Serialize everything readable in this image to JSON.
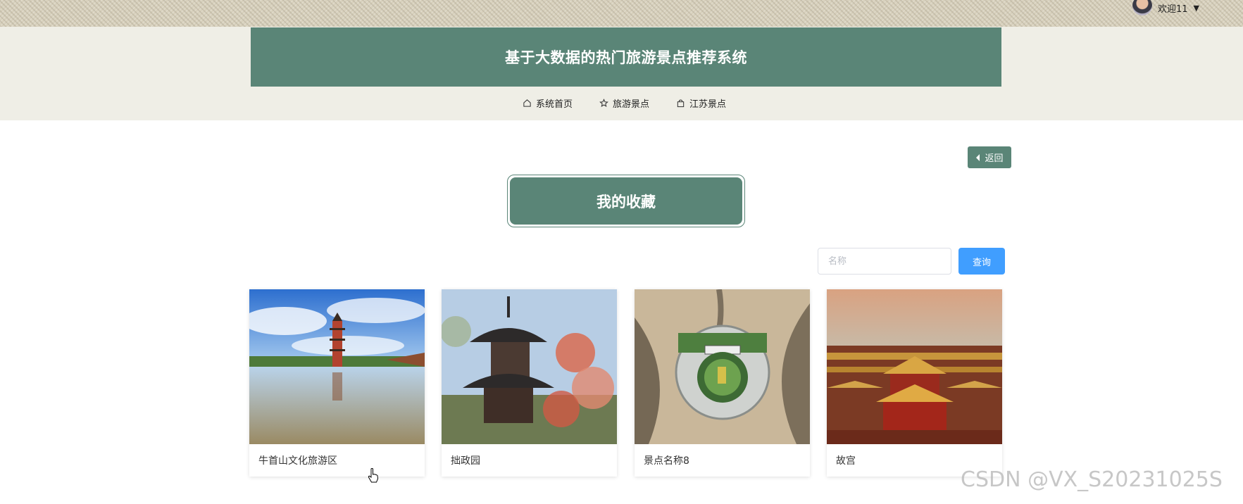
{
  "user": {
    "greeting": "欢迎11"
  },
  "header": {
    "title": "基于大数据的热门旅游景点推荐系统"
  },
  "nav": [
    {
      "label": "系统首页",
      "icon": "home-icon"
    },
    {
      "label": "旅游景点",
      "icon": "star-icon"
    },
    {
      "label": "江苏景点",
      "icon": "bag-icon"
    }
  ],
  "back_button": {
    "label": "返回"
  },
  "section": {
    "title": "我的收藏"
  },
  "search": {
    "placeholder": "名称",
    "value": "",
    "button": "查询"
  },
  "cards": [
    {
      "name": "牛首山文化旅游区"
    },
    {
      "name": "拙政园"
    },
    {
      "name": "景点名称8"
    },
    {
      "name": "故宫"
    }
  ],
  "watermark": "CSDN @VX_S20231025S",
  "colors": {
    "theme_green": "#5a8577",
    "query_blue": "#409eff"
  }
}
